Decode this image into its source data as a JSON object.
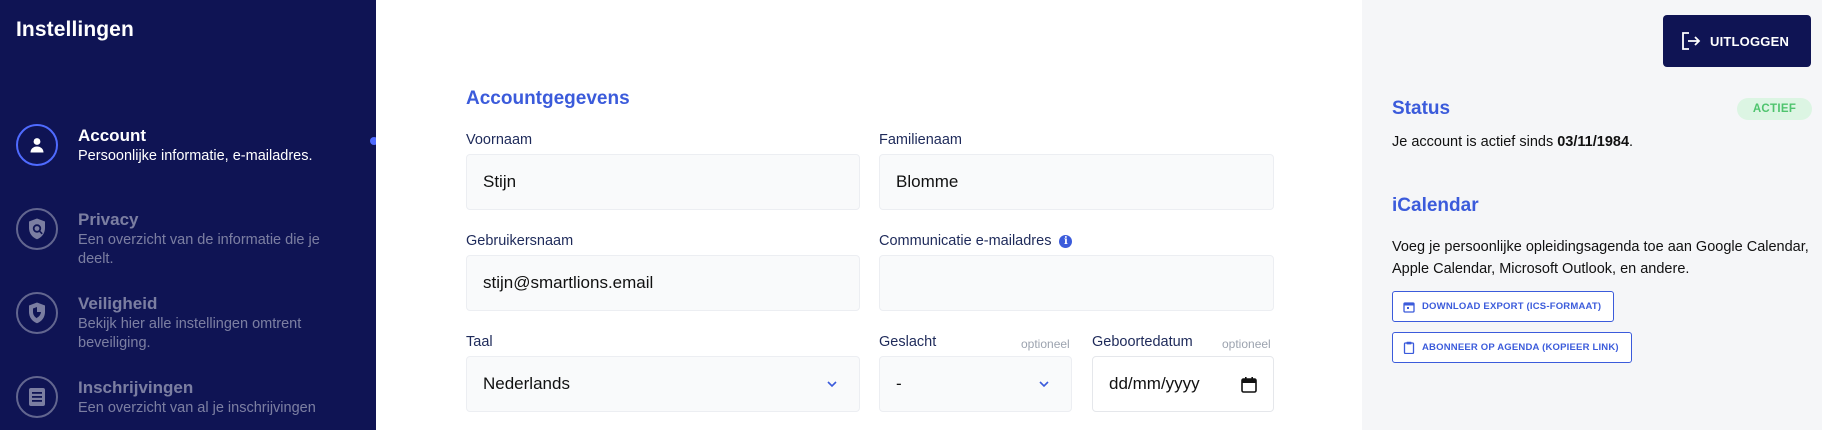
{
  "sidebar": {
    "title": "Instellingen",
    "items": [
      {
        "label": "Account",
        "description": "Persoonlijke informatie, e-mailadres.",
        "icon": "user-icon",
        "active": true
      },
      {
        "label": "Privacy",
        "description": "Een overzicht van de informatie die je deelt.",
        "icon": "privacy-shield-icon",
        "active": false
      },
      {
        "label": "Veiligheid",
        "description": "Bekijk hier alle instellingen omtrent beveiliging.",
        "icon": "security-shield-icon",
        "active": false
      },
      {
        "label": "Inschrijvingen",
        "description": "Een overzicht van al je inschrijvingen",
        "icon": "list-icon",
        "active": false
      }
    ]
  },
  "form": {
    "section_title": "Accountgegevens",
    "firstname": {
      "label": "Voornaam",
      "value": "Stijn"
    },
    "lastname": {
      "label": "Familienaam",
      "value": "Blomme"
    },
    "username": {
      "label": "Gebruikersnaam",
      "value": "stijn@smartlions.email"
    },
    "comm_email": {
      "label": "Communicatie e-mailadres",
      "value": ""
    },
    "language": {
      "label": "Taal",
      "value": "Nederlands"
    },
    "gender": {
      "label": "Geslacht",
      "optional": "optioneel",
      "value": "-"
    },
    "birthdate": {
      "label": "Geboortedatum",
      "optional": "optioneel",
      "placeholder": "dd/mm/yyyy"
    }
  },
  "panel": {
    "logout_label": "UITLOGGEN",
    "status": {
      "title": "Status",
      "badge": "ACTIEF",
      "text_before": "Je account is actief sinds ",
      "date": "03/11/1984",
      "text_after": "."
    },
    "icalendar": {
      "title": "iCalendar",
      "description": "Voeg je persoonlijke opleidingsagenda toe aan Google Calendar, Apple Calendar, Microsoft Outlook, en andere.",
      "download_label": "DOWNLOAD EXPORT (ICS-FORMAAT)",
      "subscribe_label": "ABONNEER OP AGENDA (KOPIEER LINK)"
    }
  },
  "colors": {
    "sidebar_bg": "#0f1454",
    "accent": "#3b5bdb",
    "status_badge_bg": "#dcf5e3",
    "status_badge_text": "#4fc46e"
  }
}
